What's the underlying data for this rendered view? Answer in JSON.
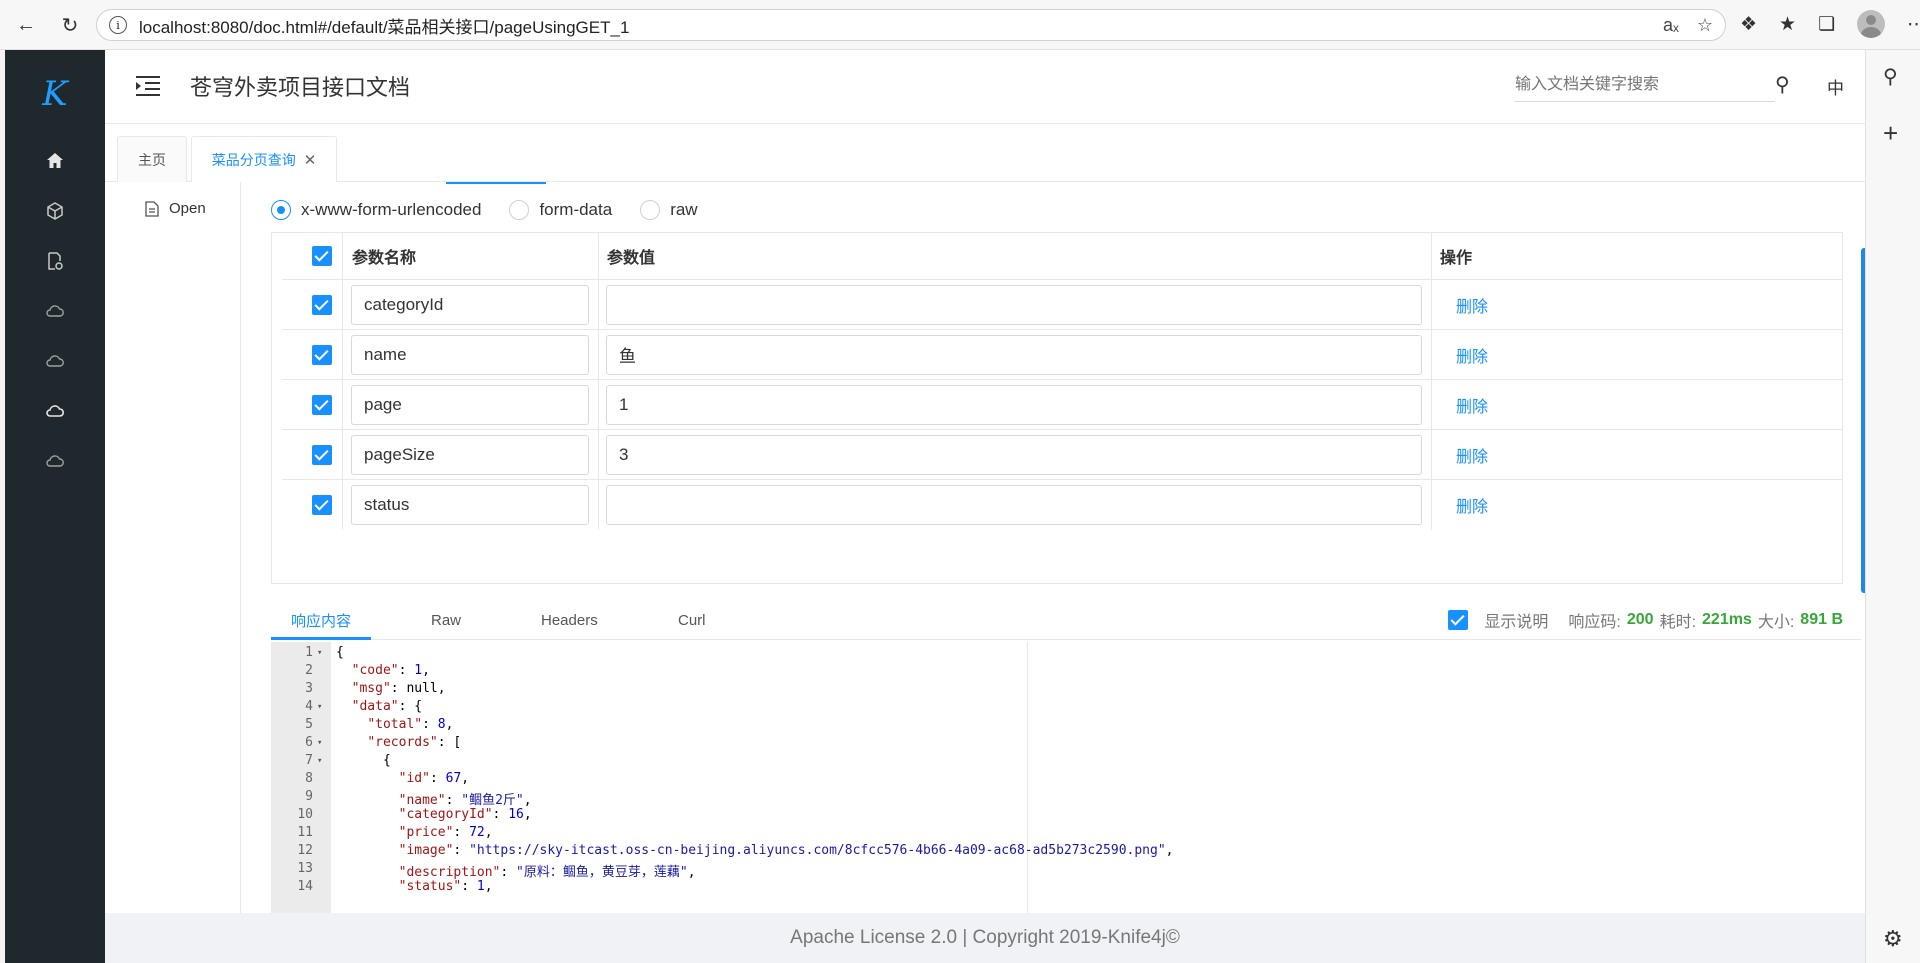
{
  "browser": {
    "url": "localhost:8080/doc.html#/default/菜品相关接口/pageUsingGET_1"
  },
  "app": {
    "title": "苍穹外卖项目接口文档",
    "search_placeholder": "输入文档关键字搜索",
    "lang": "中",
    "tabs": [
      {
        "label": "主页",
        "active": false
      },
      {
        "label": "菜品分页查询",
        "active": true
      }
    ],
    "tree_item": "Open",
    "nav_icons": [
      "home-icon",
      "api-cube-icon",
      "doc-settings-icon",
      "cloud-icon",
      "cloud-icon",
      "cloud-icon",
      "cloud-icon"
    ]
  },
  "body_types": {
    "options": [
      "x-www-form-urlencoded",
      "form-data",
      "raw"
    ],
    "selected": "x-www-form-urlencoded"
  },
  "params_table": {
    "headers": {
      "name": "参数名称",
      "value": "参数值",
      "action": "操作"
    },
    "delete_label": "删除",
    "rows": [
      {
        "name": "categoryId",
        "value": ""
      },
      {
        "name": "name",
        "value": "鱼"
      },
      {
        "name": "page",
        "value": "1"
      },
      {
        "name": "pageSize",
        "value": "3"
      },
      {
        "name": "status",
        "value": ""
      }
    ]
  },
  "response": {
    "tabs": [
      "响应内容",
      "Raw",
      "Headers",
      "Curl"
    ],
    "show_desc_label": "显示说明",
    "code_label": "响应码:",
    "code_value": "200",
    "time_label": "耗时:",
    "time_value": "221ms",
    "size_label": "大小:",
    "size_value": "891 B",
    "lines": [
      {
        "n": "1",
        "fold": true,
        "html": "{"
      },
      {
        "n": "2",
        "fold": false,
        "html": "  <span class='k'>\"code\"</span>: <span class='n'>1</span>,"
      },
      {
        "n": "3",
        "fold": false,
        "html": "  <span class='k'>\"msg\"</span>: null,"
      },
      {
        "n": "4",
        "fold": true,
        "html": "  <span class='k'>\"data\"</span>: {"
      },
      {
        "n": "5",
        "fold": false,
        "html": "    <span class='k'>\"total\"</span>: <span class='n'>8</span>,"
      },
      {
        "n": "6",
        "fold": true,
        "html": "    <span class='k'>\"records\"</span>: ["
      },
      {
        "n": "7",
        "fold": true,
        "html": "      {"
      },
      {
        "n": "8",
        "fold": false,
        "html": "        <span class='k'>\"id\"</span>: <span class='n'>67</span>,"
      },
      {
        "n": "9",
        "fold": false,
        "html": "        <span class='k'>\"name\"</span>: <span class='s'>\"鲴鱼2斤\"</span>,"
      },
      {
        "n": "10",
        "fold": false,
        "html": "        <span class='k'>\"categoryId\"</span>: <span class='n'>16</span>,"
      },
      {
        "n": "11",
        "fold": false,
        "html": "        <span class='k'>\"price\"</span>: <span class='n'>72</span>,"
      },
      {
        "n": "12",
        "fold": false,
        "html": "        <span class='k'>\"image\"</span>: <span class='s'>\"https://sky-itcast.oss-cn-beijing.aliyuncs.com/8cfcc576-4b66-4a09-ac68-ad5b273c2590.png\"</span>,"
      },
      {
        "n": "13",
        "fold": false,
        "html": "        <span class='k'>\"description\"</span>: <span class='s'>\"原料：鲴鱼，黄豆芽，莲藕\"</span>,"
      },
      {
        "n": "14",
        "fold": false,
        "html": "        <span class='k'>\"status\"</span>: <span class='n'>1</span>,"
      }
    ]
  },
  "footer": "Apache License 2.0 | Copyright 2019-Knife4j©"
}
